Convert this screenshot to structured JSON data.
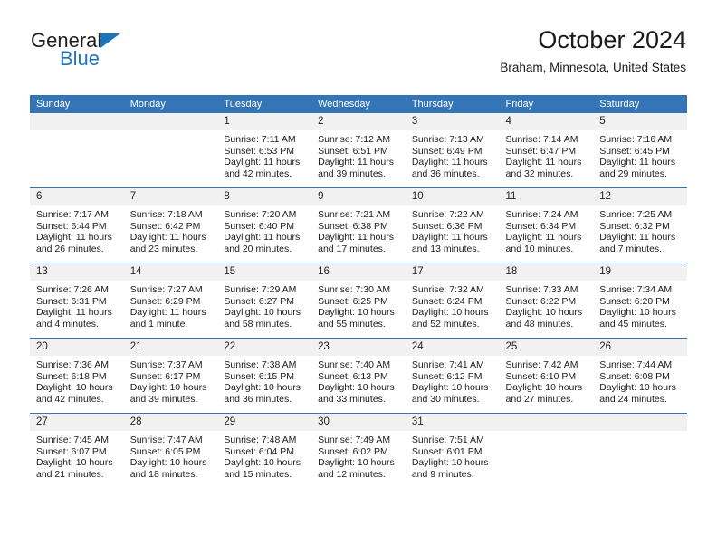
{
  "logo": {
    "text_primary": "General",
    "text_secondary": "Blue",
    "triangle_icon": "triangle-icon",
    "color_primary": "#231f20",
    "color_secondary": "#1b75bb"
  },
  "header": {
    "title": "October 2024",
    "location": "Braham, Minnesota, United States",
    "accent_color": "#3375b6",
    "daynum_background": "#f1f1f1"
  },
  "weekday_headers": [
    "Sunday",
    "Monday",
    "Tuesday",
    "Wednesday",
    "Thursday",
    "Friday",
    "Saturday"
  ],
  "labels": {
    "sunrise": "Sunrise:",
    "sunset": "Sunset:",
    "daylight": "Daylight:"
  },
  "weeks": [
    [
      {
        "day": "",
        "blank": true
      },
      {
        "day": "",
        "blank": true
      },
      {
        "day": "1",
        "sunrise": "Sunrise: 7:11 AM",
        "sunset": "Sunset: 6:53 PM",
        "daylight": "Daylight: 11 hours and 42 minutes."
      },
      {
        "day": "2",
        "sunrise": "Sunrise: 7:12 AM",
        "sunset": "Sunset: 6:51 PM",
        "daylight": "Daylight: 11 hours and 39 minutes."
      },
      {
        "day": "3",
        "sunrise": "Sunrise: 7:13 AM",
        "sunset": "Sunset: 6:49 PM",
        "daylight": "Daylight: 11 hours and 36 minutes."
      },
      {
        "day": "4",
        "sunrise": "Sunrise: 7:14 AM",
        "sunset": "Sunset: 6:47 PM",
        "daylight": "Daylight: 11 hours and 32 minutes."
      },
      {
        "day": "5",
        "sunrise": "Sunrise: 7:16 AM",
        "sunset": "Sunset: 6:45 PM",
        "daylight": "Daylight: 11 hours and 29 minutes."
      }
    ],
    [
      {
        "day": "6",
        "sunrise": "Sunrise: 7:17 AM",
        "sunset": "Sunset: 6:44 PM",
        "daylight": "Daylight: 11 hours and 26 minutes."
      },
      {
        "day": "7",
        "sunrise": "Sunrise: 7:18 AM",
        "sunset": "Sunset: 6:42 PM",
        "daylight": "Daylight: 11 hours and 23 minutes."
      },
      {
        "day": "8",
        "sunrise": "Sunrise: 7:20 AM",
        "sunset": "Sunset: 6:40 PM",
        "daylight": "Daylight: 11 hours and 20 minutes."
      },
      {
        "day": "9",
        "sunrise": "Sunrise: 7:21 AM",
        "sunset": "Sunset: 6:38 PM",
        "daylight": "Daylight: 11 hours and 17 minutes."
      },
      {
        "day": "10",
        "sunrise": "Sunrise: 7:22 AM",
        "sunset": "Sunset: 6:36 PM",
        "daylight": "Daylight: 11 hours and 13 minutes."
      },
      {
        "day": "11",
        "sunrise": "Sunrise: 7:24 AM",
        "sunset": "Sunset: 6:34 PM",
        "daylight": "Daylight: 11 hours and 10 minutes."
      },
      {
        "day": "12",
        "sunrise": "Sunrise: 7:25 AM",
        "sunset": "Sunset: 6:32 PM",
        "daylight": "Daylight: 11 hours and 7 minutes."
      }
    ],
    [
      {
        "day": "13",
        "sunrise": "Sunrise: 7:26 AM",
        "sunset": "Sunset: 6:31 PM",
        "daylight": "Daylight: 11 hours and 4 minutes."
      },
      {
        "day": "14",
        "sunrise": "Sunrise: 7:27 AM",
        "sunset": "Sunset: 6:29 PM",
        "daylight": "Daylight: 11 hours and 1 minute."
      },
      {
        "day": "15",
        "sunrise": "Sunrise: 7:29 AM",
        "sunset": "Sunset: 6:27 PM",
        "daylight": "Daylight: 10 hours and 58 minutes."
      },
      {
        "day": "16",
        "sunrise": "Sunrise: 7:30 AM",
        "sunset": "Sunset: 6:25 PM",
        "daylight": "Daylight: 10 hours and 55 minutes."
      },
      {
        "day": "17",
        "sunrise": "Sunrise: 7:32 AM",
        "sunset": "Sunset: 6:24 PM",
        "daylight": "Daylight: 10 hours and 52 minutes."
      },
      {
        "day": "18",
        "sunrise": "Sunrise: 7:33 AM",
        "sunset": "Sunset: 6:22 PM",
        "daylight": "Daylight: 10 hours and 48 minutes."
      },
      {
        "day": "19",
        "sunrise": "Sunrise: 7:34 AM",
        "sunset": "Sunset: 6:20 PM",
        "daylight": "Daylight: 10 hours and 45 minutes."
      }
    ],
    [
      {
        "day": "20",
        "sunrise": "Sunrise: 7:36 AM",
        "sunset": "Sunset: 6:18 PM",
        "daylight": "Daylight: 10 hours and 42 minutes."
      },
      {
        "day": "21",
        "sunrise": "Sunrise: 7:37 AM",
        "sunset": "Sunset: 6:17 PM",
        "daylight": "Daylight: 10 hours and 39 minutes."
      },
      {
        "day": "22",
        "sunrise": "Sunrise: 7:38 AM",
        "sunset": "Sunset: 6:15 PM",
        "daylight": "Daylight: 10 hours and 36 minutes."
      },
      {
        "day": "23",
        "sunrise": "Sunrise: 7:40 AM",
        "sunset": "Sunset: 6:13 PM",
        "daylight": "Daylight: 10 hours and 33 minutes."
      },
      {
        "day": "24",
        "sunrise": "Sunrise: 7:41 AM",
        "sunset": "Sunset: 6:12 PM",
        "daylight": "Daylight: 10 hours and 30 minutes."
      },
      {
        "day": "25",
        "sunrise": "Sunrise: 7:42 AM",
        "sunset": "Sunset: 6:10 PM",
        "daylight": "Daylight: 10 hours and 27 minutes."
      },
      {
        "day": "26",
        "sunrise": "Sunrise: 7:44 AM",
        "sunset": "Sunset: 6:08 PM",
        "daylight": "Daylight: 10 hours and 24 minutes."
      }
    ],
    [
      {
        "day": "27",
        "sunrise": "Sunrise: 7:45 AM",
        "sunset": "Sunset: 6:07 PM",
        "daylight": "Daylight: 10 hours and 21 minutes."
      },
      {
        "day": "28",
        "sunrise": "Sunrise: 7:47 AM",
        "sunset": "Sunset: 6:05 PM",
        "daylight": "Daylight: 10 hours and 18 minutes."
      },
      {
        "day": "29",
        "sunrise": "Sunrise: 7:48 AM",
        "sunset": "Sunset: 6:04 PM",
        "daylight": "Daylight: 10 hours and 15 minutes."
      },
      {
        "day": "30",
        "sunrise": "Sunrise: 7:49 AM",
        "sunset": "Sunset: 6:02 PM",
        "daylight": "Daylight: 10 hours and 12 minutes."
      },
      {
        "day": "31",
        "sunrise": "Sunrise: 7:51 AM",
        "sunset": "Sunset: 6:01 PM",
        "daylight": "Daylight: 10 hours and 9 minutes."
      },
      {
        "day": "",
        "blank": true
      },
      {
        "day": "",
        "blank": true
      }
    ]
  ]
}
